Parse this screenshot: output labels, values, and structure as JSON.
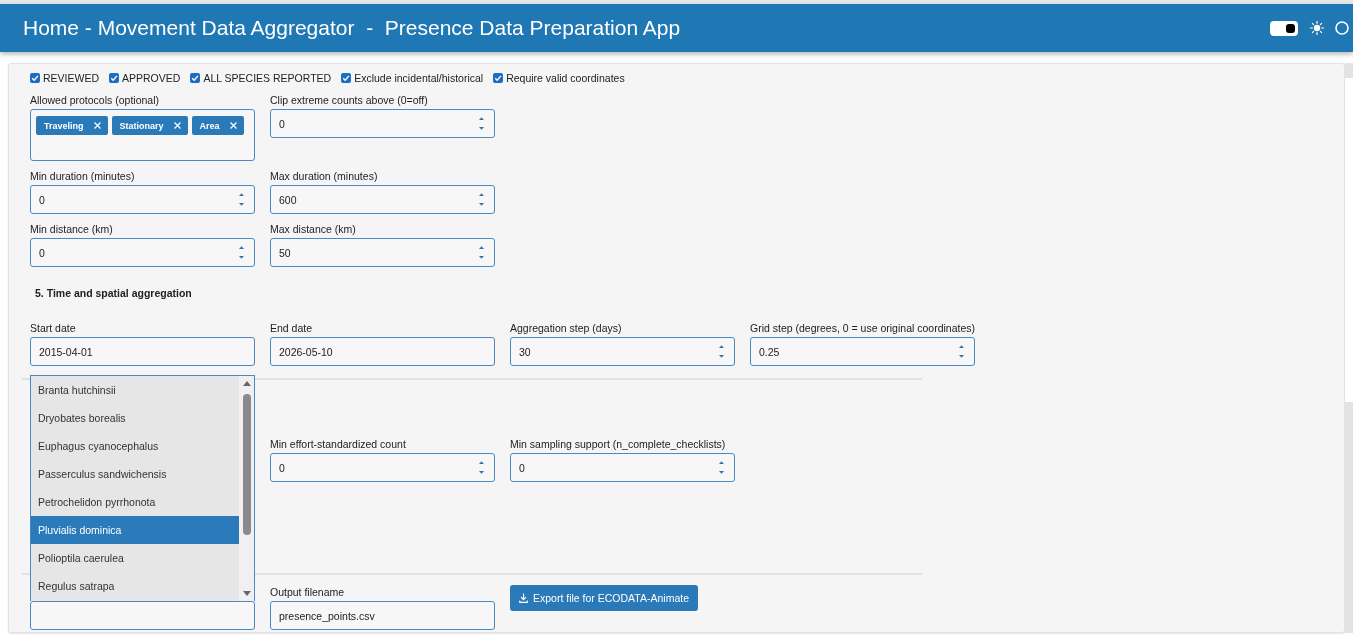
{
  "header": {
    "title": "Home - Movement Data Aggregator  -  Presence Data Preparation App",
    "theme_switch": {
      "on": true
    }
  },
  "quality_filters": [
    {
      "label": "REVIEWED",
      "checked": true
    },
    {
      "label": "APPROVED",
      "checked": true
    },
    {
      "label": "ALL SPECIES REPORTED",
      "checked": true
    },
    {
      "label": "Exclude incidental/historical",
      "checked": true
    },
    {
      "label": "Require valid coordinates",
      "checked": true
    }
  ],
  "filter_rows": [
    [
      {
        "kind": "tags",
        "label": "Allowed protocols (optional)",
        "tags": [
          "Traveling",
          "Stationary",
          "Area"
        ]
      },
      {
        "kind": "number",
        "label": "Clip extreme counts above (0=off)",
        "value": "0"
      }
    ],
    [
      {
        "kind": "number",
        "label": "Min duration (minutes)",
        "value": "0"
      },
      {
        "kind": "number",
        "label": "Max duration (minutes)",
        "value": "600"
      }
    ],
    [
      {
        "kind": "number",
        "label": "Min distance (km)",
        "value": "0"
      },
      {
        "kind": "number",
        "label": "Max distance (km)",
        "value": "50"
      }
    ]
  ],
  "aggregation": {
    "title": "5. Time and spatial aggregation",
    "fields": [
      {
        "kind": "date",
        "label": "Start date",
        "value": "2015-04-01"
      },
      {
        "kind": "date",
        "label": "End date",
        "value": "2026-05-10"
      },
      {
        "kind": "number",
        "label": "Aggregation step (days)",
        "value": "30"
      },
      {
        "kind": "number",
        "label": "Grid step (degrees, 0 = use original coordinates)",
        "value": "0.25"
      }
    ]
  },
  "thresholds": {
    "fields": [
      {
        "kind": "number",
        "label": "Min effort-standardized count",
        "value": "0"
      },
      {
        "kind": "number",
        "label": "Min sampling support (n_complete_checklists)",
        "value": "0"
      }
    ]
  },
  "export": {
    "species_select": {
      "expanded": true,
      "options": [
        {
          "label": "Branta hutchinsii",
          "selected": false
        },
        {
          "label": "Dryobates borealis",
          "selected": false
        },
        {
          "label": "Euphagus cyanocephalus",
          "selected": false
        },
        {
          "label": "Passerculus sandwichensis",
          "selected": false
        },
        {
          "label": "Petrochelidon pyrrhonota",
          "selected": false
        },
        {
          "label": "Pluvialis dominica",
          "selected": true
        },
        {
          "label": "Polioptila caerulea",
          "selected": false
        },
        {
          "label": "Regulus satrapa",
          "selected": false
        }
      ]
    },
    "fields": [
      {
        "kind": "text",
        "label": "Output filename",
        "value": "presence_points.csv"
      }
    ],
    "export_button": {
      "label": "Export file for ECODATA-Animate"
    }
  }
}
